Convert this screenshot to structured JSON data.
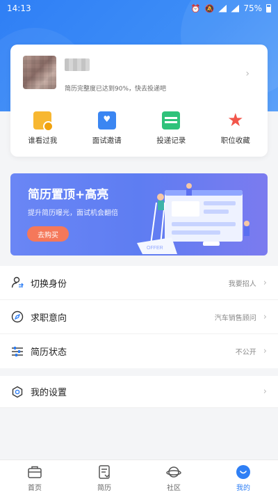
{
  "status_bar": {
    "time": "14:13",
    "battery": "75%"
  },
  "profile": {
    "progress_text": "简历完整度已达到90%，快去投递吧",
    "quick_actions": [
      {
        "label": "谁看过我",
        "icon": "viewed-me-icon"
      },
      {
        "label": "面试邀请",
        "icon": "interview-invite-icon"
      },
      {
        "label": "投递记录",
        "icon": "delivery-record-icon"
      },
      {
        "label": "职位收藏",
        "icon": "favorite-star-icon"
      }
    ]
  },
  "banner": {
    "title": "简历置顶+高亮",
    "subtitle": "提升简历曝光，面试机会翻倍",
    "button": "去购买",
    "illustration_text": "OFFER"
  },
  "menu": [
    {
      "label": "切换身份",
      "value": "我要招人",
      "icon": "switch-identity-icon"
    },
    {
      "label": "求职意向",
      "value": "汽车销售顾问",
      "icon": "job-intent-icon"
    },
    {
      "label": "简历状态",
      "value": "不公开",
      "icon": "resume-status-icon"
    }
  ],
  "settings": {
    "label": "我的设置",
    "icon": "settings-icon"
  },
  "tabbar": [
    {
      "label": "首页",
      "icon": "home-icon"
    },
    {
      "label": "简历",
      "icon": "resume-icon"
    },
    {
      "label": "社区",
      "icon": "community-icon"
    },
    {
      "label": "我的",
      "icon": "profile-icon"
    }
  ],
  "colors": {
    "brand_blue": "#2f7ff5",
    "banner_button": "#f5785a"
  }
}
